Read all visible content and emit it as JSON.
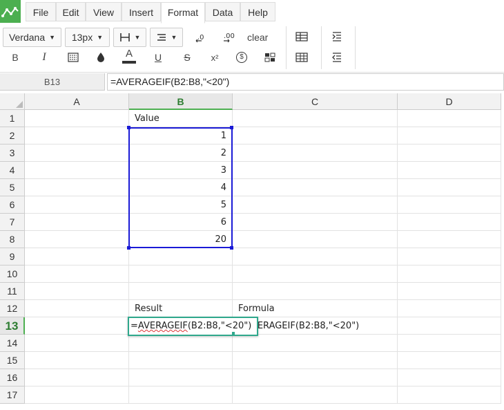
{
  "menu": {
    "items": [
      {
        "label": "File"
      },
      {
        "label": "Edit"
      },
      {
        "label": "View"
      },
      {
        "label": "Insert"
      },
      {
        "label": "Format"
      },
      {
        "label": "Data"
      },
      {
        "label": "Help"
      }
    ],
    "active": "Format"
  },
  "toolbar": {
    "font_family": "Verdana",
    "font_size": "13px",
    "clear_label": "clear",
    "bold_label": "B",
    "italic_label": "I",
    "color_label": "A",
    "underline_label": "U",
    "strike_label": "S",
    "superscript_label": "x²",
    "currency_label": "$"
  },
  "formula_bar": {
    "cell_ref": "B13",
    "formula": "=AVERAGEIF(B2:B8,\"<20\")"
  },
  "columns": [
    "A",
    "B",
    "C",
    "D"
  ],
  "rows": [
    "1",
    "2",
    "3",
    "4",
    "5",
    "6",
    "7",
    "8",
    "9",
    "10",
    "11",
    "12",
    "13",
    "14",
    "15",
    "16",
    "17"
  ],
  "selected_column": "B",
  "selected_row": "13",
  "cells": {
    "B1": "Value",
    "B2": "1",
    "B3": "2",
    "B4": "3",
    "B5": "4",
    "B6": "5",
    "B7": "6",
    "B8": "20",
    "B12": "Result",
    "C12": "Formula",
    "C13": "=AVERAGEIF(B2:B8,\"<20\")"
  },
  "editor": {
    "prefix": "=",
    "func": "AVERAGEIF",
    "range": "(B2:B8",
    "rest": ",\"<20\")"
  },
  "colors": {
    "logo": "#4caf50",
    "selection_range": "#1a1ad6",
    "editor_border": "#2fa88c",
    "header_highlight": "#2e7d32"
  }
}
